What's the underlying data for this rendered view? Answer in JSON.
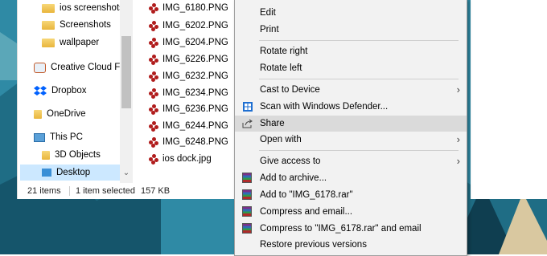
{
  "sidebar": {
    "items": [
      {
        "label": "ios screenshots",
        "icon": "folder-icon"
      },
      {
        "label": "Screenshots",
        "icon": "folder-icon"
      },
      {
        "label": "wallpaper",
        "icon": "folder-icon"
      },
      {
        "label": "Creative Cloud File",
        "icon": "creative-cloud-icon"
      },
      {
        "label": "Dropbox",
        "icon": "dropbox-icon"
      },
      {
        "label": "OneDrive",
        "icon": "onedrive-icon"
      },
      {
        "label": "This PC",
        "icon": "this-pc-icon"
      },
      {
        "label": "3D Objects",
        "icon": "3d-objects-icon"
      },
      {
        "label": "Desktop",
        "icon": "desktop-icon"
      }
    ]
  },
  "files": [
    "IMG_6180.PNG",
    "IMG_6202.PNG",
    "IMG_6204.PNG",
    "IMG_6226.PNG",
    "IMG_6232.PNG",
    "IMG_6234.PNG",
    "IMG_6236.PNG",
    "IMG_6244.PNG",
    "IMG_6248.PNG",
    "ios dock.jpg"
  ],
  "status": {
    "count": "21 items",
    "selected": "1 item selected",
    "size": "157 KB"
  },
  "context_menu": {
    "edit": "Edit",
    "print": "Print",
    "rotate_right": "Rotate right",
    "rotate_left": "Rotate left",
    "cast": "Cast to Device",
    "scan": "Scan with Windows Defender...",
    "share": "Share",
    "open_with": "Open with",
    "give_access": "Give access to",
    "add_archive": "Add to archive...",
    "add_rar": "Add to \"IMG_6178.rar\"",
    "compress_email": "Compress and email...",
    "compress_rar_email": "Compress to \"IMG_6178.rar\" and email",
    "restore": "Restore previous versions"
  },
  "colors": {
    "selection": "#cce8ff",
    "menu_bg": "#f2f2f2",
    "menu_hover": "#dadada",
    "wallpaper": "#2f7f9a"
  }
}
